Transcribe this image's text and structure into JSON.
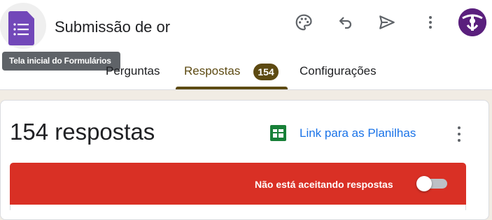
{
  "header": {
    "doc_title": "Submissão de or",
    "tooltip": "Tela inicial do Formulários",
    "icons": [
      "palette-icon",
      "undo-icon",
      "send-icon",
      "more-vert-icon",
      "avatar"
    ]
  },
  "tabs": [
    {
      "label": "Perguntas"
    },
    {
      "label": "Respostas",
      "badge": "154",
      "active": true
    },
    {
      "label": "Configurações"
    }
  ],
  "responses": {
    "count_label": "154 respostas",
    "sheets_link": "Link para as Planilhas",
    "banner_text": "Não está aceitando respostas",
    "accepting": false
  },
  "colors": {
    "accent": "#5d4a12",
    "forms_purple": "#7248b9",
    "banner_red": "#d93025",
    "link_blue": "#1a73e8",
    "sheets_green": "#188038"
  }
}
